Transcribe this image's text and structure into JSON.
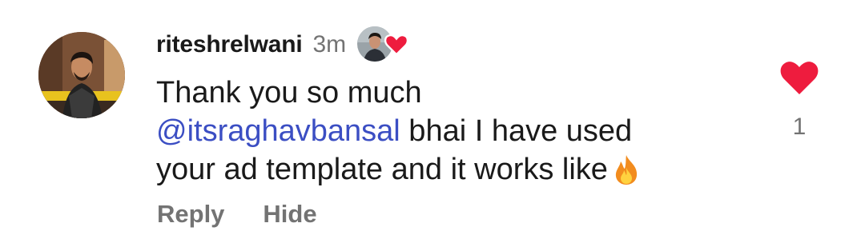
{
  "comment": {
    "username": "riteshrelwani",
    "time": "3m",
    "text_line1": "Thank you so much",
    "mention": "@itsraghavbansal",
    "text_line2_rest": " bhai I have used",
    "text_line3": "your ad template and it works like",
    "emoji_icon": "fire-icon",
    "liked_by_icon": "creator-heart-icon"
  },
  "actions": {
    "reply_label": "Reply",
    "hide_label": "Hide"
  },
  "like": {
    "icon": "heart-icon",
    "count": "1",
    "color": "#ee1c3e"
  },
  "colors": {
    "mention": "#3b4ec3",
    "muted": "#737373",
    "text": "#1a1a1a",
    "heart": "#ee1c3e"
  }
}
